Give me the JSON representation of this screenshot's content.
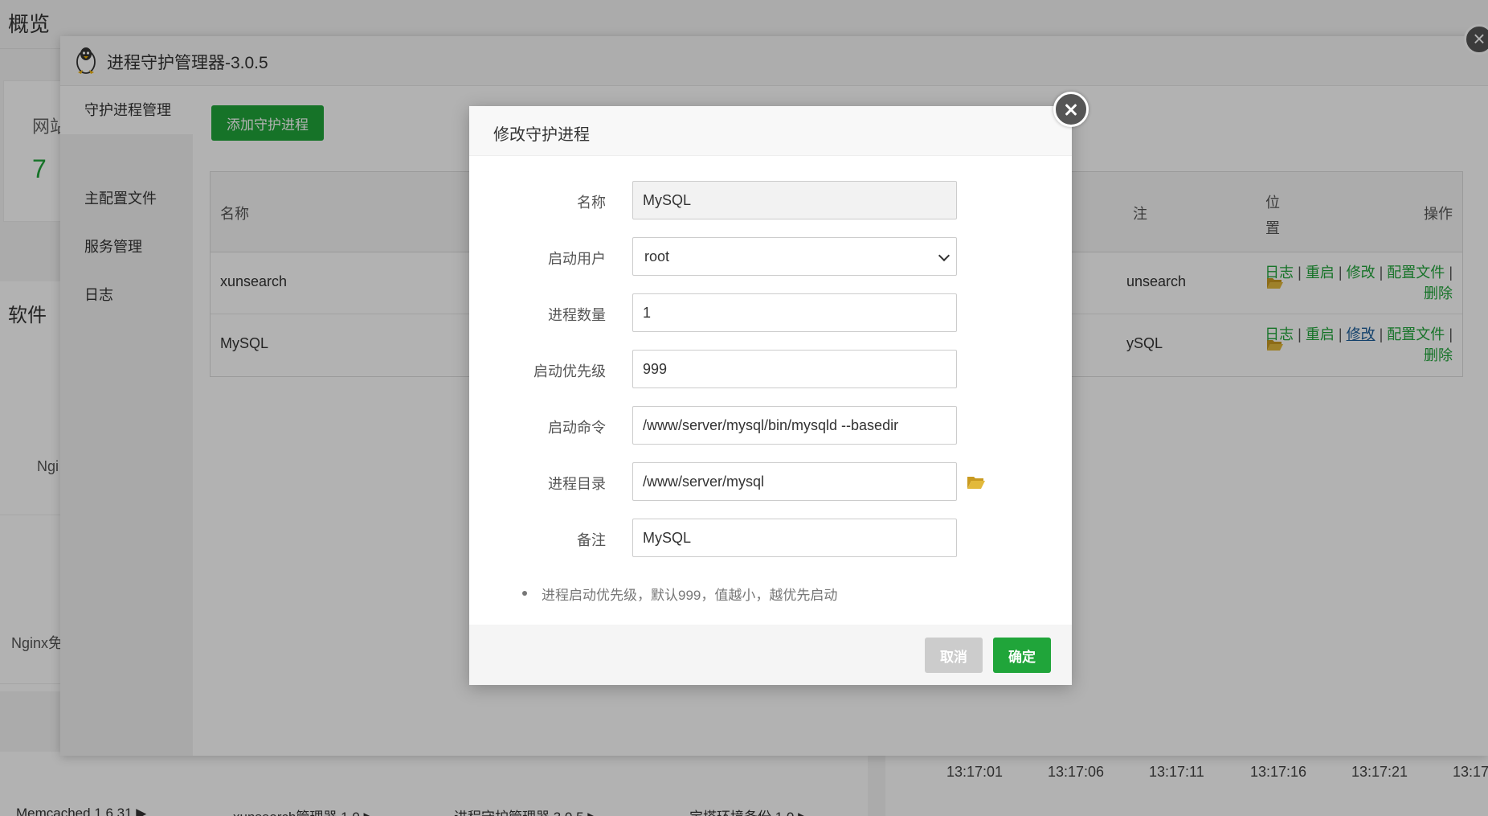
{
  "background": {
    "page_title": "概览",
    "card_label": "网站",
    "card_value": "7",
    "section_title": "软件",
    "software_1": "Ngi",
    "software_2": "Nginx免",
    "apps": [
      "Memcached 1.6.31 ▶",
      "xunsearch管理器 1.0 ▶",
      "进程守护管理器 3.0.5 ▶",
      "宝塔环境备份 1.0 ▶"
    ],
    "chart_ticks": [
      "13:17:01",
      "13:17:06",
      "13:17:11",
      "13:17:16",
      "13:17:21",
      "13:17"
    ]
  },
  "plugin": {
    "title": "进程守护管理器-3.0.5",
    "sidebar": [
      {
        "label": "守护进程管理"
      },
      {
        "label": "主配置文件"
      },
      {
        "label": "服务管理"
      },
      {
        "label": "日志"
      }
    ],
    "add_button": "添加守护进程",
    "table": {
      "headers": {
        "name": "名称",
        "remark": "注",
        "position": "位置",
        "ops": "操作"
      },
      "rows": [
        {
          "name": "xunsearch",
          "remark": "unsearch"
        },
        {
          "name": "MySQL",
          "remark": "ySQL"
        }
      ],
      "ops": {
        "log": "日志",
        "restart": "重启",
        "edit": "修改",
        "config": "配置文件",
        "delete": "删除"
      },
      "sep": "|"
    }
  },
  "modal": {
    "title": "修改守护进程",
    "fields": {
      "name_label": "名称",
      "name_value": "MySQL",
      "user_label": "启动用户",
      "user_value": "root",
      "count_label": "进程数量",
      "count_value": "1",
      "priority_label": "启动优先级",
      "priority_value": "999",
      "command_label": "启动命令",
      "command_value": "/www/server/mysql/bin/mysqld --basedir",
      "dir_label": "进程目录",
      "dir_value": "/www/server/mysql",
      "remark_label": "备注",
      "remark_value": "MySQL"
    },
    "tip": "进程启动优先级，默认999，值越小，越优先启动",
    "cancel": "取消",
    "confirm": "确定"
  },
  "colors": {
    "accent": "#20a53a",
    "folder": "#d4a72c",
    "link_hover": "#1a5d9a"
  }
}
